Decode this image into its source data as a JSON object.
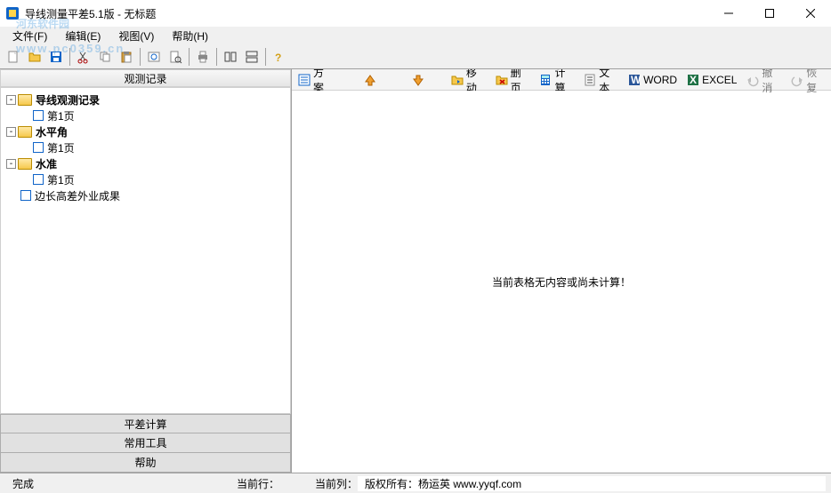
{
  "window": {
    "title": "导线测量平差5.1版 - 无标题"
  },
  "watermark": {
    "main": "河东软件园",
    "sub": "www.pc0359.cn"
  },
  "menu": {
    "file": "文件(F)",
    "edit": "编辑(E)",
    "view": "视图(V)",
    "help": "帮助(H)"
  },
  "left_panel": {
    "header": "观测记录",
    "tree": {
      "n0": {
        "label": "导线观测记录",
        "bold": true
      },
      "n0_0": {
        "label": "第1页"
      },
      "n1": {
        "label": "水平角",
        "bold": true
      },
      "n1_0": {
        "label": "第1页"
      },
      "n2": {
        "label": "水准",
        "bold": true
      },
      "n2_0": {
        "label": "第1页"
      },
      "n3": {
        "label": "边长高差外业成果"
      }
    },
    "buttons": {
      "calc": "平差计算",
      "tools": "常用工具",
      "help": "帮助"
    }
  },
  "right_toolbar": {
    "scheme": "方案",
    "move": "移动",
    "delete": "删页",
    "calc": "计算",
    "text": "文本",
    "word": "WORD",
    "excel": "EXCEL",
    "undo": "撤消",
    "redo": "恢复"
  },
  "right_content": {
    "message": "当前表格无内容或尚未计算！"
  },
  "statusbar": {
    "ready": "完成",
    "row": "当前行：",
    "col": "当前列：",
    "copyright": "版权所有：杨运英 www.yyqf.com"
  }
}
